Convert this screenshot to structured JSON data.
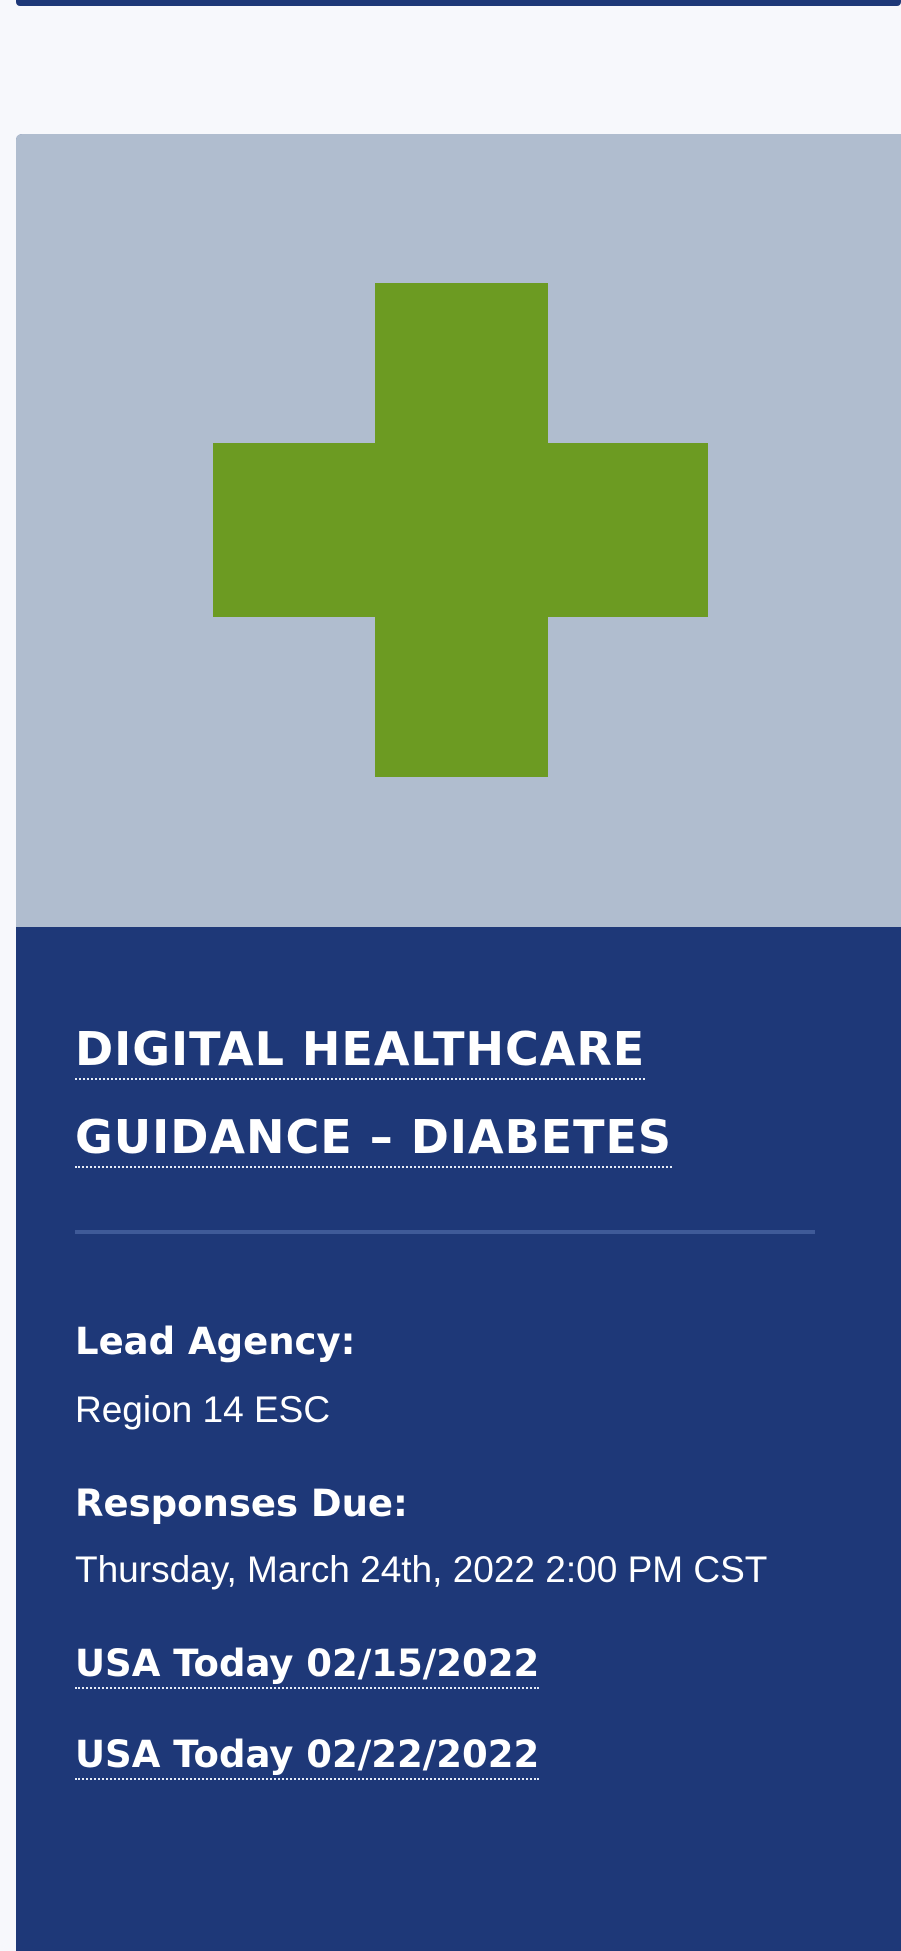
{
  "card": {
    "image_icon": "green-cross-icon",
    "title_line1": "DIGITAL HEALTHCARE",
    "title_line2": "GUIDANCE – DIABETES",
    "lead_agency_label": "Lead Agency:",
    "lead_agency_value": "Region 14 ESC",
    "responses_due_label": "Responses Due:",
    "responses_due_value": "Thursday, March 24th, 2022 2:00 PM CST",
    "links": [
      "USA Today 02/15/2022",
      "USA Today 02/22/2022"
    ]
  },
  "colors": {
    "card_body": "#1e3878",
    "image_background": "#b0bdcf",
    "cross": "#6c9b22",
    "text": "#ffffff"
  }
}
